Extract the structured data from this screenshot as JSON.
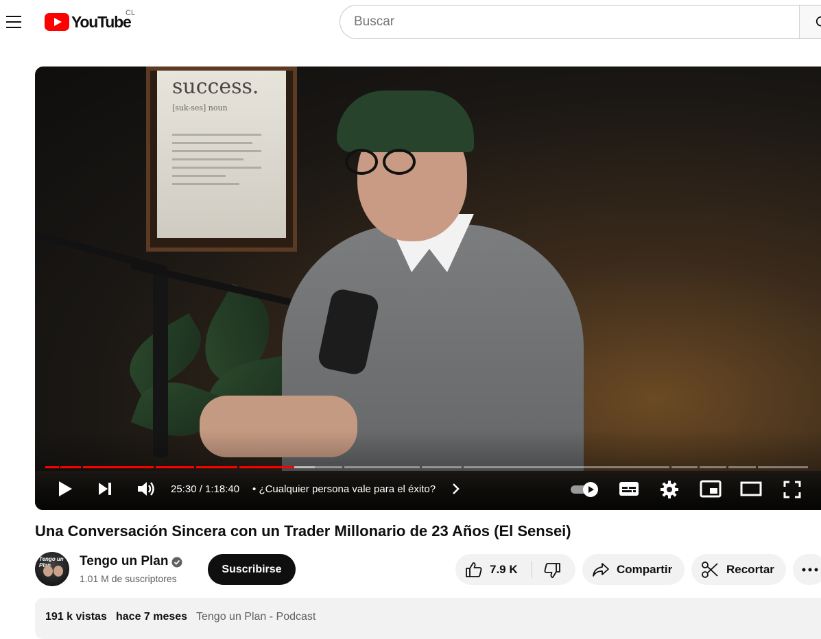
{
  "header": {
    "logo_text": "YouTube",
    "country_code": "CL",
    "search_placeholder": "Buscar",
    "icons": [
      "menu-icon",
      "search-icon"
    ]
  },
  "player": {
    "poster_text": "success.",
    "poster_sub": "[suk-ses] noun",
    "current_time": "25:30",
    "duration": "1:18:40",
    "time_display": "25:30 / 1:18:40",
    "chapter_bullet": "•",
    "chapter_title": "¿Cualquier persona vale para el éxito?",
    "progress_played_fraction": 0.324,
    "progress_buffered_fraction": 0.35,
    "autoplay": true,
    "accent_color": "#ff0000",
    "icons": [
      "play-icon",
      "next-icon",
      "volume-icon",
      "chevron-right-icon",
      "autoplay-toggle",
      "subtitles-icon",
      "settings-gear-icon",
      "miniplayer-icon",
      "theater-mode-icon",
      "fullscreen-icon"
    ]
  },
  "video": {
    "title": "Una Conversación Sincera con un Trader Millonario de 23 Años (El Sensei)"
  },
  "channel": {
    "name": "Tengo un Plan",
    "subscribers": "1.01 M de suscriptores",
    "avatar_text": "Tengo un Plan",
    "verified": true,
    "subscribe_label": "Suscribirse"
  },
  "actions": {
    "like_count": "7.9 K",
    "share_label": "Compartir",
    "clip_label": "Recortar",
    "icons": [
      "thumbs-up-icon",
      "thumbs-down-icon",
      "share-icon",
      "scissors-icon",
      "more-icon"
    ]
  },
  "description": {
    "views": "191 k vistas",
    "ago": "hace 7 meses",
    "tag": "Tengo un Plan - Podcast"
  }
}
